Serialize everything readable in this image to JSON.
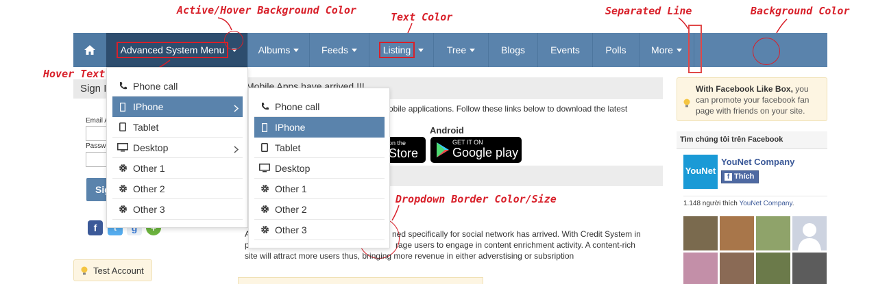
{
  "annotations": {
    "active_hover_bg": "Active/Hover Background Color",
    "text_color": "Text Color",
    "separated_line": "Separated Line",
    "background_color": "Background Color",
    "hover_text_color": "Hover Text Color",
    "dropdown_border": "Dropdown Border Color/Size"
  },
  "nav": {
    "items": [
      "Advanced System Menu",
      "Albums",
      "Feeds",
      "Listing",
      "Tree",
      "Blogs",
      "Events",
      "Polls",
      "More"
    ],
    "home_icon": "home-icon",
    "colors": {
      "bar": "#5a83ac",
      "active": "#2d4d6e",
      "annotation": "#d8202a"
    }
  },
  "dropdown1": {
    "items": [
      "Phone call",
      "IPhone",
      "Tablet",
      "Desktop",
      "Other 1",
      "Other 2",
      "Other 3"
    ]
  },
  "dropdown2": {
    "items": [
      "Phone call",
      "IPhone",
      "Tablet",
      "Desktop",
      "Other 1",
      "Other 2",
      "Other 3"
    ]
  },
  "left": {
    "sign_in": "Sign I",
    "email_label": "Email A",
    "password_label": "Passw",
    "sign_btn": "Sig",
    "test_account": "Test Account"
  },
  "main": {
    "mobile_title": "Mobile Apps have arrived !!!",
    "mobile_text": "obile applications. Follow these links below to download the latest",
    "android_label": "Android",
    "appstore_small": "on the",
    "appstore_big": "Store",
    "googleplay_small": "GET IT ON",
    "googleplay_big": "Google play",
    "para_line1_a": "A",
    "para_line1_b": "ned specifically for social network has arrived. With Credit System in",
    "para_line2_a": "p",
    "para_line2_b": "rage users to engage in content enrichment activity. A content-rich",
    "para_line3": "site will attract more users thus, bringing more revenue in either adverstising or subsription"
  },
  "right": {
    "fb_like_bold": "With Facebook Like Box,",
    "fb_like_rest": " you can promote your facebook fan page with friends on your site.",
    "fb_header": "Tìm chúng tôi trên Facebook",
    "logo_text": "YouNet",
    "company": "YouNet Company",
    "like_btn": "Thích",
    "fans_prefix": "1.148 người thích ",
    "fans_link": "YouNet Company",
    "fans_suffix": "."
  }
}
